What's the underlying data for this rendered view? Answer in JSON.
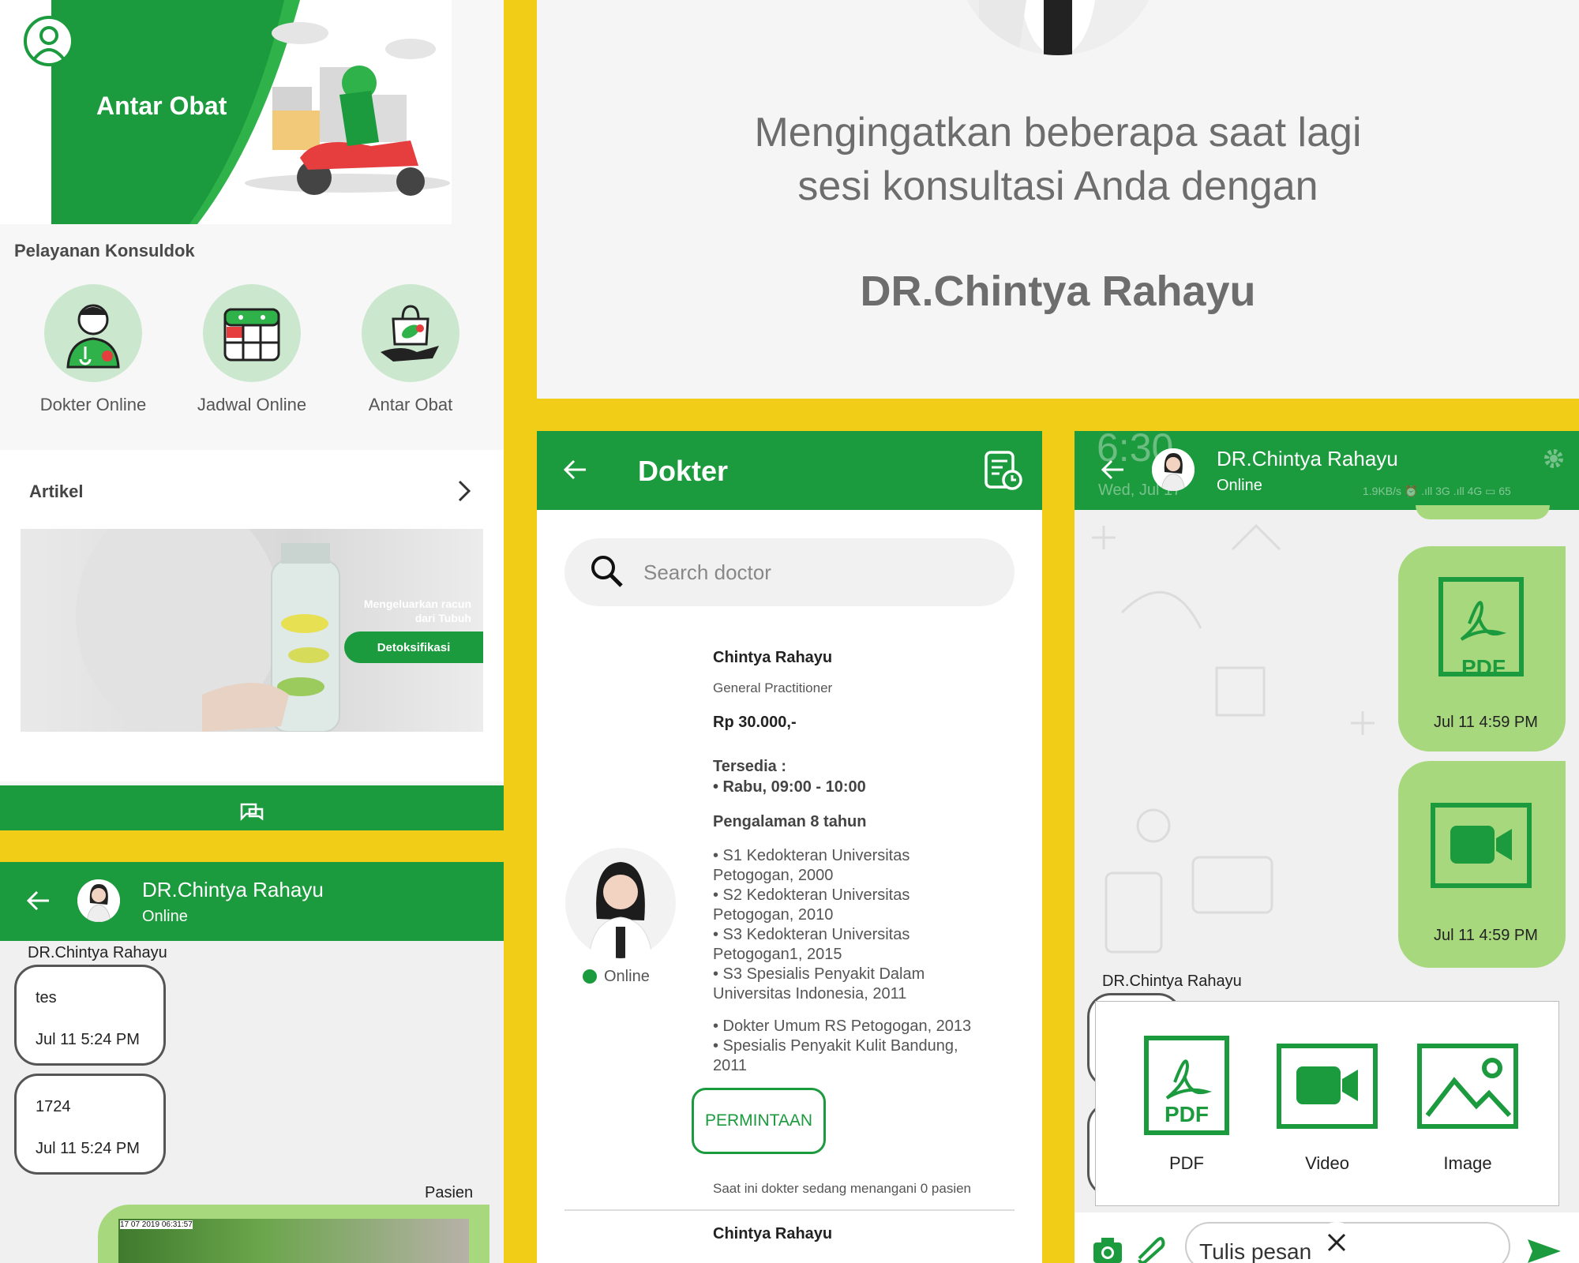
{
  "home": {
    "banner_title": "Antar Obat",
    "services_title": "Pelayanan Konsuldok",
    "services": [
      {
        "label": "Dokter Online",
        "icon": "doctor-icon"
      },
      {
        "label": "Jadwal Online",
        "icon": "calendar-icon"
      },
      {
        "label": "Antar Obat",
        "icon": "medicine-bag-icon"
      }
    ],
    "article_title": "Artikel",
    "article_text_line1": "Mengeluarkan racun",
    "article_text_line2": "dari Tubuh",
    "article_button": "Detoksifikasi"
  },
  "chat_small": {
    "doctor_name": "DR.Chintya Rahayu",
    "status": "Online",
    "sender_label": "DR.Chintya Rahayu",
    "messages": [
      {
        "text": "tes",
        "time": "Jul 11 5:24 PM"
      },
      {
        "text": "1724",
        "time": "Jul 11 5:24 PM"
      }
    ],
    "patient_label": "Pasien",
    "photo_stamp": "17 07 2019 06:31:57"
  },
  "reminder": {
    "line1": "Mengingatkan beberapa saat lagi",
    "line2": "sesi konsultasi Anda dengan",
    "doctor": "DR.Chintya Rahayu"
  },
  "doctor_page": {
    "title": "Dokter",
    "search_placeholder": "Search doctor",
    "name": "Chintya Rahayu",
    "specialty": "General Practitioner",
    "price": "Rp 30.000,-",
    "available_label": "Tersedia :",
    "schedule": "• Rabu, 09:00 - 10:00",
    "experience": "Pengalaman 8 tahun",
    "edu": [
      "• S1 Kedokteran Universitas",
      "Petogogan, 2000",
      "• S2 Kedokteran Universitas",
      "Petogogan, 2010",
      "• S3 Kedokteran Universitas",
      "Petogogan1, 2015",
      "• S3 Spesialis Penyakit Dalam",
      "Universitas Indonesia, 2011"
    ],
    "work": [
      "• Dokter Umum RS Petogogan, 2013",
      "• Spesialis Penyakit Kulit Bandung,",
      "2011"
    ],
    "online_label": "Online",
    "request_button": "PERMINTAAN",
    "patients_note": "Saat ini dokter sedang menangani 0 pasien",
    "next_name": "Chintya Rahayu"
  },
  "chat_attach": {
    "doctor_name": "DR.Chintya Rahayu",
    "status": "Online",
    "status_bar_time": "6:30",
    "status_bar_date": "Wed, Jul 17",
    "status_bar_info": "1.9KB/s ⏰ .ıll 3G .ıll 4G ▭ 65",
    "file_times": [
      "Jul 11 4:59 PM",
      "Jul 11 4:59 PM"
    ],
    "pdf_label": "PDF",
    "sender_label": "DR.Chintya Rahayu",
    "attach_options": [
      "PDF",
      "Video",
      "Image"
    ],
    "input_placeholder": "Tulis pesan"
  },
  "colors": {
    "primary": "#1c9a3e",
    "light_green": "#a8d87e",
    "yellow": "#f2cd17"
  }
}
